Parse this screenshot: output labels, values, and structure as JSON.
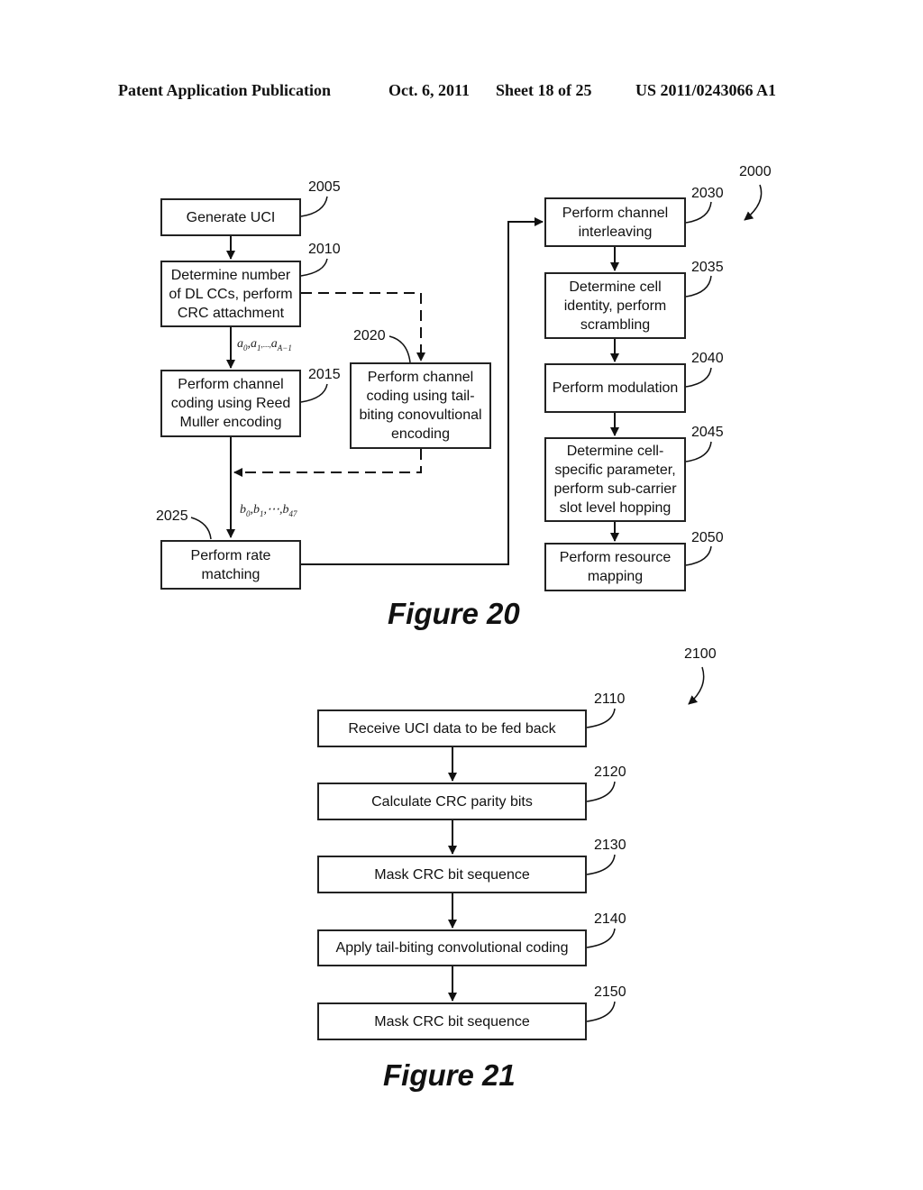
{
  "header": {
    "publication": "Patent Application Publication",
    "date": "Oct. 6, 2011",
    "sheet": "Sheet 18 of 25",
    "number": "US 2011/0243066 A1"
  },
  "figure20": {
    "label": "Figure 20",
    "ref": "2000",
    "steps": [
      {
        "ref": "2005",
        "text": "Generate UCI"
      },
      {
        "ref": "2010",
        "text": "Determine number of DL CCs, perform CRC attachment"
      },
      {
        "ref": "2015",
        "text": "Perform channel coding using Reed Muller encoding"
      },
      {
        "ref": "2020",
        "text": "Perform channel coding using tail-biting conovultional encoding"
      },
      {
        "ref": "2025",
        "text": "Perform rate matching"
      },
      {
        "ref": "2030",
        "text": "Perform channel interleaving"
      },
      {
        "ref": "2035",
        "text": "Determine cell identity, perform scrambling"
      },
      {
        "ref": "2040",
        "text": "Perform modulation"
      },
      {
        "ref": "2045",
        "text": "Determine cell-specific parameter, perform sub-carrier slot level hopping"
      },
      {
        "ref": "2050",
        "text": "Perform resource mapping"
      }
    ],
    "signal_a": {
      "base": "a",
      "s0": "0",
      "s1": "1",
      "sep": ",...,",
      "sn": "A−1"
    },
    "signal_b": {
      "base": "b",
      "s0": "0",
      "s1": "1",
      "sep": ",⋯,",
      "sn": "47"
    }
  },
  "figure21": {
    "label": "Figure 21",
    "ref": "2100",
    "steps": [
      {
        "ref": "2110",
        "text": "Receive UCI data to be fed back"
      },
      {
        "ref": "2120",
        "text": "Calculate CRC parity bits"
      },
      {
        "ref": "2130",
        "text": "Mask CRC bit sequence"
      },
      {
        "ref": "2140",
        "text": "Apply tail-biting convolutional coding"
      },
      {
        "ref": "2150",
        "text": "Mask CRC bit sequence"
      }
    ]
  }
}
